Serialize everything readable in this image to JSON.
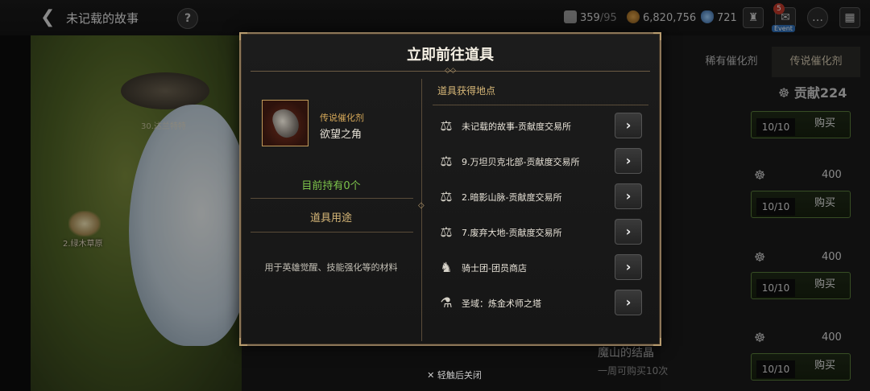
{
  "header": {
    "back_icon": "chevron-left-icon",
    "title": "未记载的故事",
    "help_label": "?",
    "stamina_value": "359",
    "stamina_max": "/95",
    "gold_value": "6,820,756",
    "crystal_value": "721",
    "mail_badge": "5",
    "event_label": "Event"
  },
  "background": {
    "map_label_1": "2.绿木草原",
    "map_label_2": "30.达兰特特",
    "tab_rare": "稀有催化剂",
    "tab_legend": "传说催化剂",
    "contribution": "贡献224",
    "rows": [
      {
        "count": "10/10",
        "buy": "购买"
      },
      {
        "count": "10/10",
        "buy": "购买",
        "price": "400"
      },
      {
        "count": "10/10",
        "buy": "购买",
        "price": "400"
      },
      {
        "count": "10/10",
        "buy": "购买",
        "price": "400"
      }
    ],
    "last_item_name": "魔山的结晶",
    "last_item_limit": "一周可购买10次"
  },
  "modal": {
    "title": "立即前往道具",
    "item": {
      "category": "传说催化剂",
      "name": "欲望之角",
      "icon": "horn-icon"
    },
    "holding": "目前持有0个",
    "usage_heading": "道具用途",
    "usage_desc": "用于英雄觉醒、技能强化等的材料",
    "sources_heading": "道具获得地点",
    "sources": [
      {
        "label": "未记载的故事-贡献度交易所",
        "icon": "scale-icon"
      },
      {
        "label": "9.万坦贝克北部-贡献度交易所",
        "icon": "scale-icon"
      },
      {
        "label": "2.暗影山脉-贡献度交易所",
        "icon": "scale-icon"
      },
      {
        "label": "7.废弃大地-贡献度交易所",
        "icon": "scale-icon"
      },
      {
        "label": "骑士团-团员商店",
        "icon": "knight-shop-icon"
      },
      {
        "label": "圣域：炼金术师之塔",
        "icon": "alchemist-icon"
      }
    ],
    "go_arrow": "›"
  },
  "close_hint": "✕ 轻触后关闭"
}
